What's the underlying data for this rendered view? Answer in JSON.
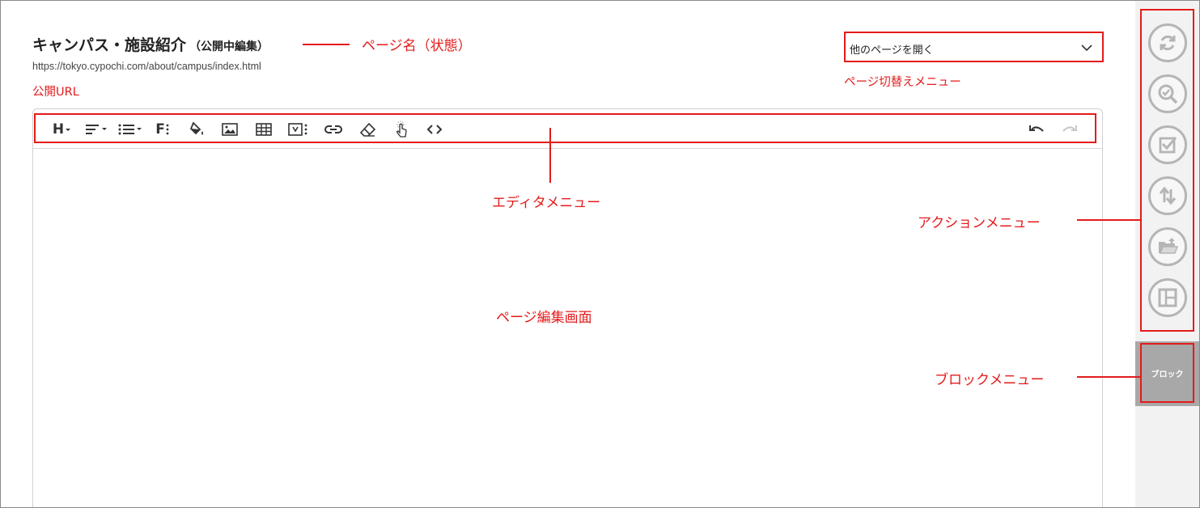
{
  "page": {
    "title": "キャンパス・施設紹介",
    "status": "（公開中編集）",
    "url": "https://tokyo.cypochi.com/about/campus/index.html"
  },
  "page_switch": {
    "selected": "他のページを開く"
  },
  "toolbar": {
    "heading_label": "H",
    "font_label": "F",
    "items": [
      "heading-icon",
      "align-icon",
      "list-icon",
      "font-icon",
      "fill-color-icon",
      "image-icon",
      "table-icon",
      "media-icon",
      "link-icon",
      "eraser-icon",
      "pointer-icon",
      "code-icon",
      "undo-icon",
      "redo-icon"
    ]
  },
  "action_menu": {
    "items": [
      "refresh-icon",
      "preview-icon",
      "check-icon",
      "sort-icon",
      "folder-upload-icon",
      "layout-icon"
    ]
  },
  "block_menu": {
    "label": "ブロック"
  },
  "annotations": {
    "page_name": "ページ名（状態）",
    "public_url": "公開URL",
    "page_switch_menu": "ページ切替えメニュー",
    "editor_menu": "エディタメニュー",
    "action_menu": "アクションメニュー",
    "edit_area": "ページ編集画面",
    "block_menu": "ブロックメニュー"
  },
  "colors": {
    "annotation": "#e41b1b",
    "action_button_border": "#b5b5b5",
    "block_button_bg": "#a8a8a8",
    "side_panel_bg": "#f2f2f2"
  }
}
